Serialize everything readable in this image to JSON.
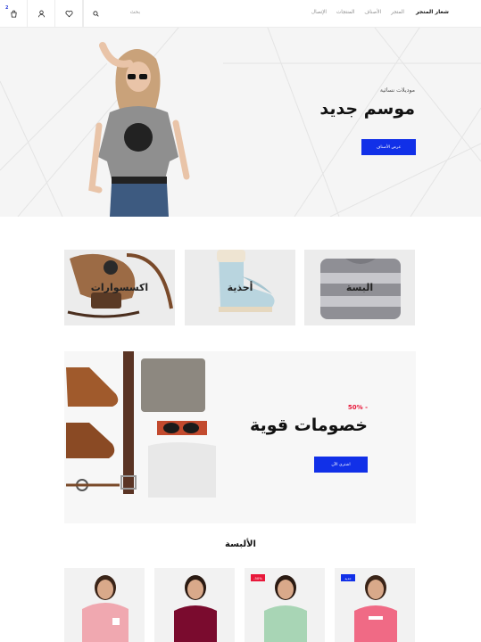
{
  "header": {
    "cart_count": "2",
    "search_placeholder": "بحث",
    "nav": [
      "المتجر",
      "الأصناف",
      "المنتجات",
      "الإتصال"
    ],
    "logo": "شعار المتجر"
  },
  "hero": {
    "subtitle": "موديلات نسائية",
    "title": "موسم جديد",
    "button": "عرض الأصناف"
  },
  "categories": [
    {
      "label": "البسة"
    },
    {
      "label": "أحذية"
    },
    {
      "label": "اكسسوارات"
    }
  ],
  "promo": {
    "badge": "50% -",
    "title": "خصومات قوية",
    "button": "اشتري الآن"
  },
  "products_section": {
    "title": "الألبسة",
    "items": [
      {
        "badge": "جديد",
        "badge_color": "#1130e8",
        "shirt_color": "#f06a85"
      },
      {
        "badge": "-50%",
        "badge_color": "#e8183a",
        "shirt_color": "#a8d5b5"
      },
      {
        "badge": "",
        "badge_color": "",
        "shirt_color": "#7a0b2e"
      },
      {
        "badge": "",
        "badge_color": "",
        "shirt_color": "#f0a8b0"
      }
    ]
  },
  "colors": {
    "accent": "#1130e8",
    "sale": "#e8183a"
  }
}
